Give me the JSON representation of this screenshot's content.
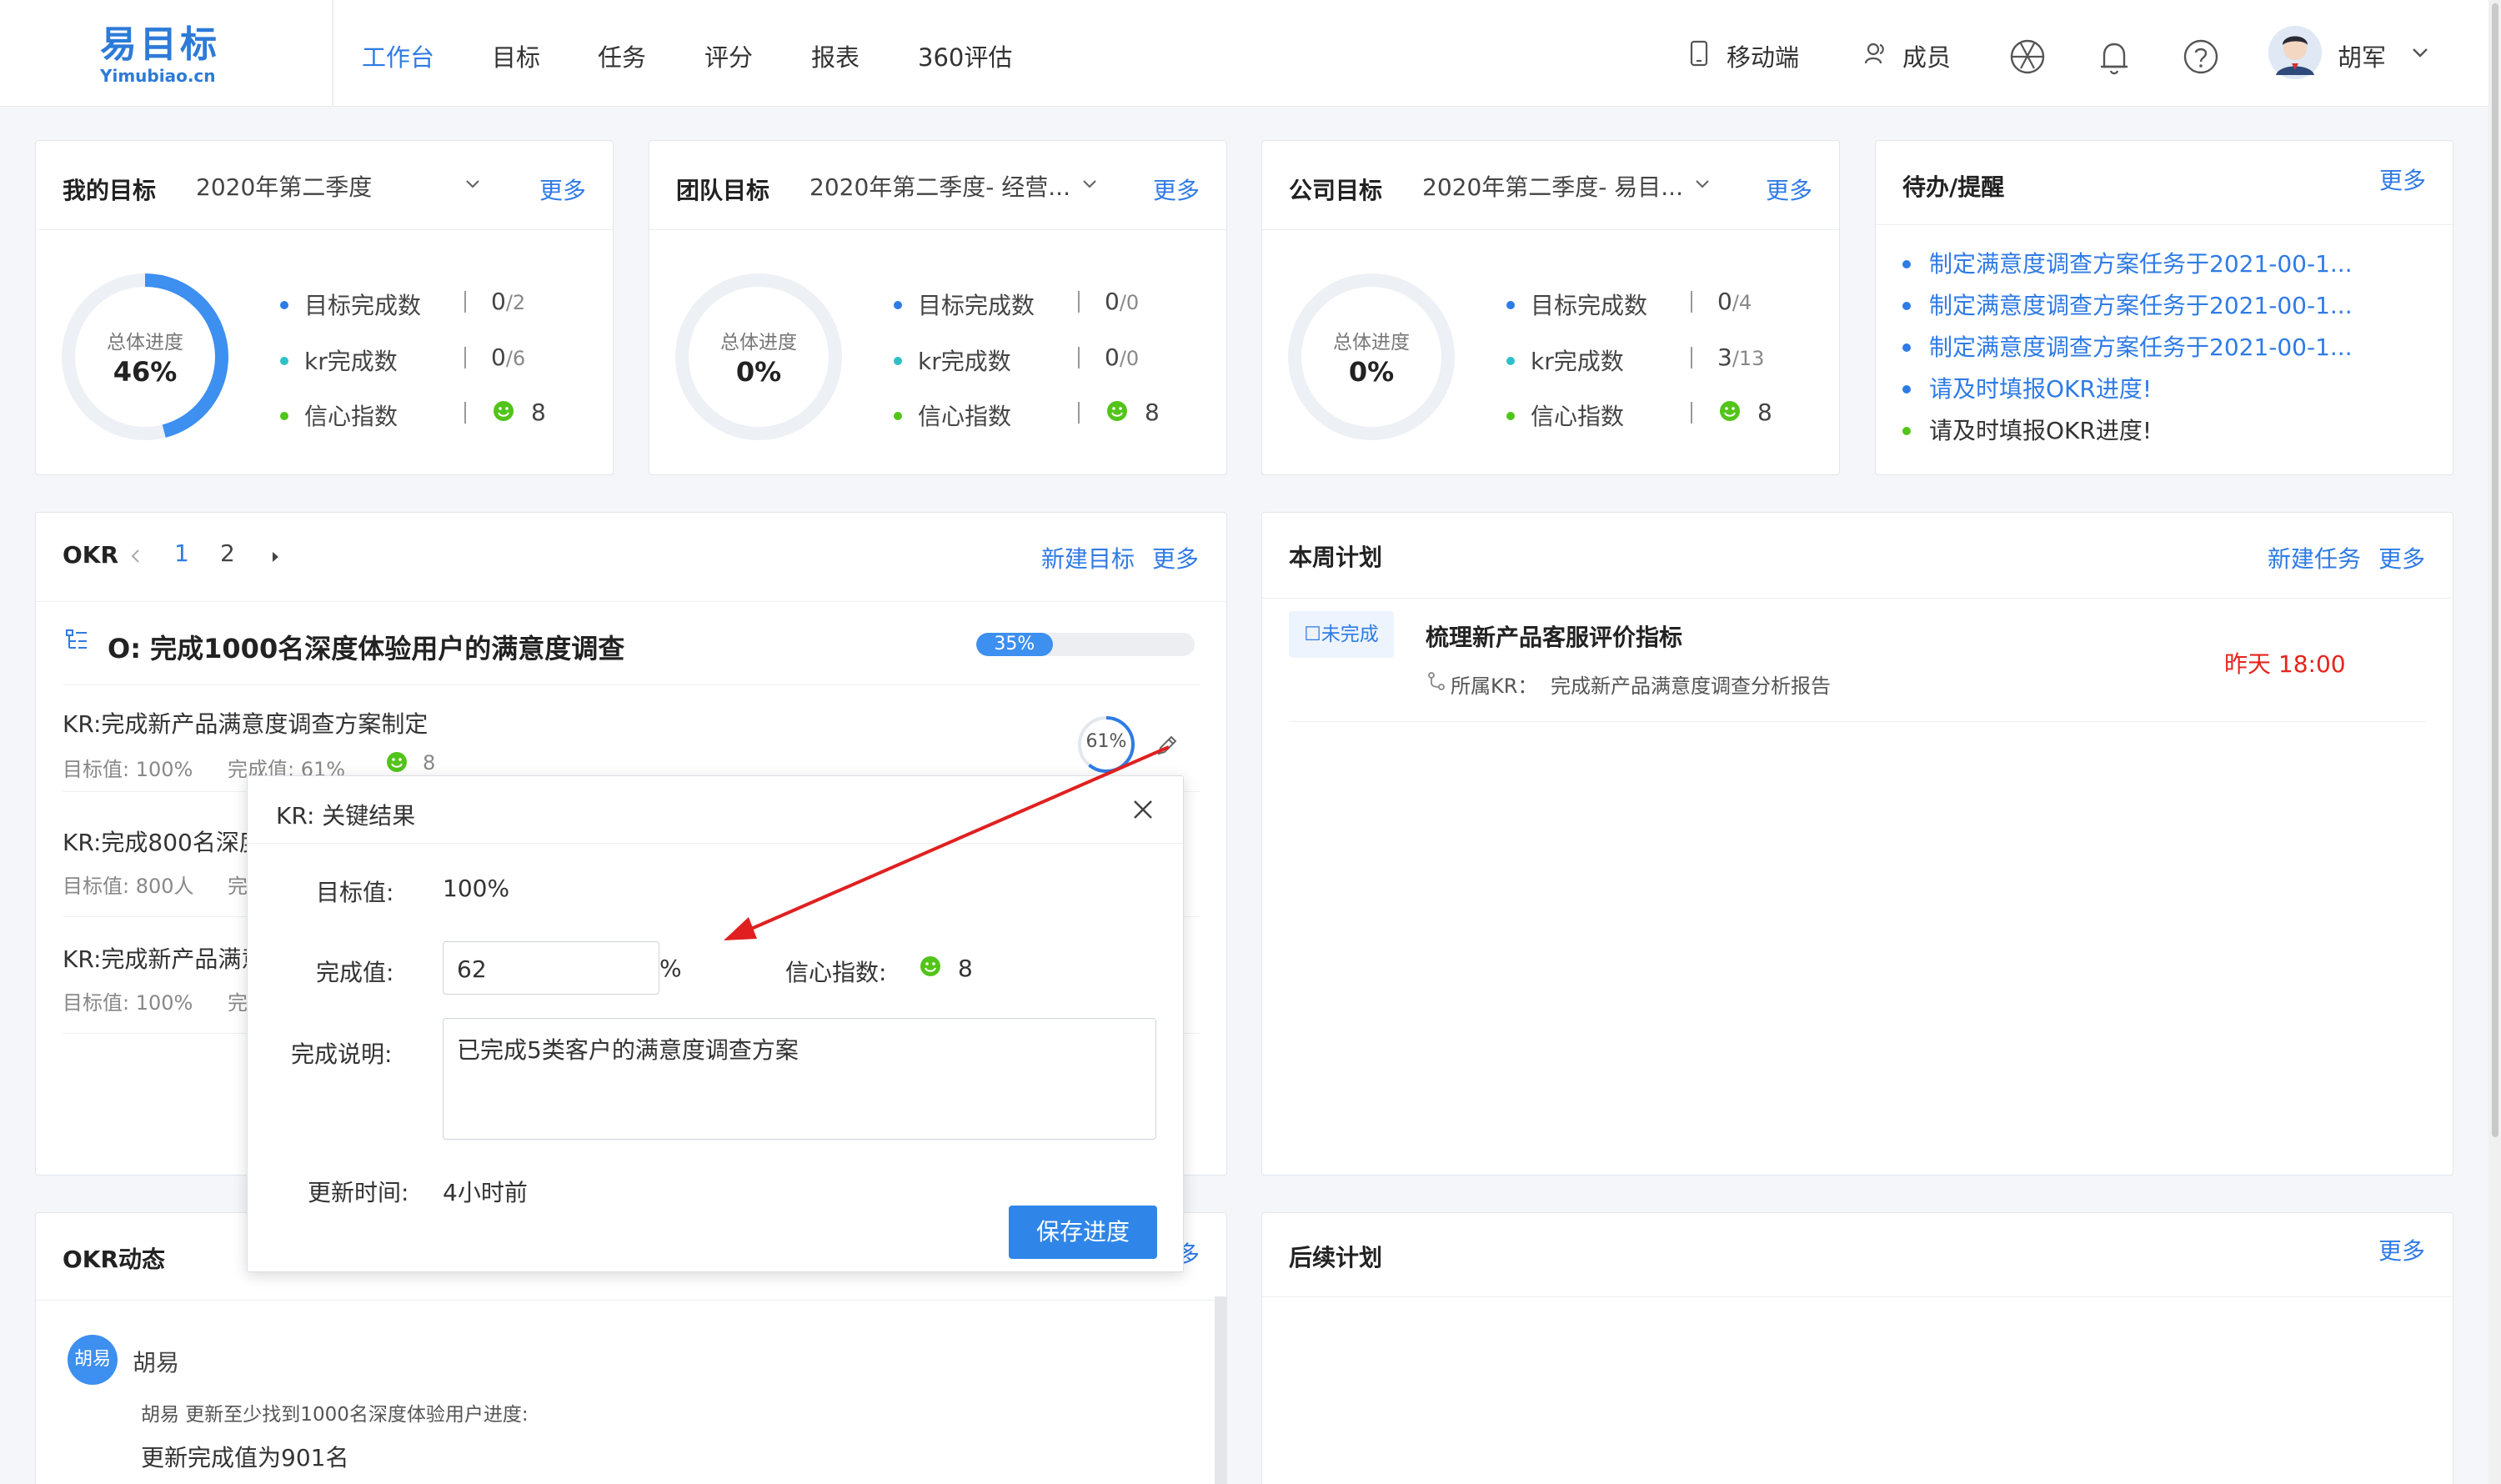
{
  "app": {
    "logo_cn": "易目标",
    "logo_en": "Yimubiao.cn"
  },
  "nav": [
    "工作台",
    "目标",
    "任务",
    "评分",
    "报表",
    "360评估"
  ],
  "header_right": {
    "mobile": "移动端",
    "members": "成员",
    "user": "胡军"
  },
  "stat_labels": {
    "total": "总体进度",
    "goal_done": "目标完成数",
    "kr_done": "kr完成数",
    "confidence": "信心指数"
  },
  "my_goal": {
    "title": "我的目标",
    "period": "2020年第二季度",
    "more": "更多",
    "progress": "46%",
    "progress_value": 0.46,
    "goal_done": "0",
    "goal_total": "/2",
    "kr_done": "0",
    "kr_total": "/6",
    "confidence": "8"
  },
  "team_goal": {
    "title": "团队目标",
    "period": "2020年第二季度- 经营...",
    "more": "更多",
    "progress": "0%",
    "progress_value": 0,
    "goal_done": "0",
    "goal_total": "/0",
    "kr_done": "0",
    "kr_total": "/0",
    "confidence": "8"
  },
  "company_goal": {
    "title": "公司目标",
    "period": "2020年第二季度- 易目...",
    "more": "更多",
    "progress": "0%",
    "progress_value": 0,
    "goal_done": "0",
    "goal_total": "/4",
    "kr_done": "3",
    "kr_total": "/13",
    "confidence": "8"
  },
  "todo": {
    "title": "待办/提醒",
    "more": "更多",
    "items": [
      {
        "text": "制定满意度调查方案任务于2021-00-1...",
        "color": "#2f7be5",
        "dot": "#2f7be5"
      },
      {
        "text": "制定满意度调查方案任务于2021-00-1...",
        "color": "#2f7be5",
        "dot": "#2f7be5"
      },
      {
        "text": "制定满意度调查方案任务于2021-00-1...",
        "color": "#2f7be5",
        "dot": "#2f7be5"
      },
      {
        "text": "请及时填报OKR进度!",
        "color": "#2f7be5",
        "dot": "#2f7be5"
      },
      {
        "text": "请及时填报OKR进度!",
        "color": "#333333",
        "dot": "#52c41a"
      }
    ]
  },
  "okr": {
    "title": "OKR",
    "pages": [
      "1",
      "2"
    ],
    "new_goal": "新建目标",
    "more": "更多",
    "objective": "O: 完成1000名深度体验用户的满意度调查",
    "objective_progress": "35%",
    "objective_progress_value": 0.35,
    "krs": [
      {
        "title": "KR:完成新产品满意度调查方案制定",
        "target": "目标值: 100%",
        "done": "完成值: 61%",
        "confidence": "8",
        "progress": "61%",
        "progress_value": 0.61
      },
      {
        "title": "KR:完成800名深度",
        "target": "目标值: 800人",
        "done": "完"
      },
      {
        "title": "KR:完成新产品满意",
        "target": "目标值: 100%",
        "done": "完"
      }
    ]
  },
  "week_plan": {
    "title": "本周计划",
    "new_task": "新建任务",
    "more": "更多",
    "task": {
      "status": "☐未完成",
      "name": "梳理新产品客服评价指标",
      "kr_label": "所属KR：",
      "kr_name": "完成新产品满意度调查分析报告",
      "due": "昨天 18:00"
    }
  },
  "okr_feed": {
    "title": "OKR动态",
    "more_partial": "多",
    "avatar_text": "胡易",
    "user": "胡易",
    "line1": "胡易 更新至少找到1000名深度体验用户进度:",
    "line2": "更新完成值为901名"
  },
  "next_plan": {
    "title": "后续计划",
    "more": "更多"
  },
  "modal": {
    "title": "KR: 关键结果",
    "target_label": "目标值:",
    "target_value": "100%",
    "done_label": "完成值:",
    "done_value": "62",
    "done_unit": "%",
    "confidence_label": "信心指数:",
    "confidence_value": "8",
    "desc_label": "完成说明:",
    "desc_value": "已完成5类客户的满意度调查方案",
    "update_label": "更新时间:",
    "update_value": "4小时前",
    "save_button": "保存进度"
  },
  "colors": {
    "accent": "#2f7be5",
    "success": "#52c41a",
    "danger": "#e8231d",
    "arrow": "#e02020"
  }
}
